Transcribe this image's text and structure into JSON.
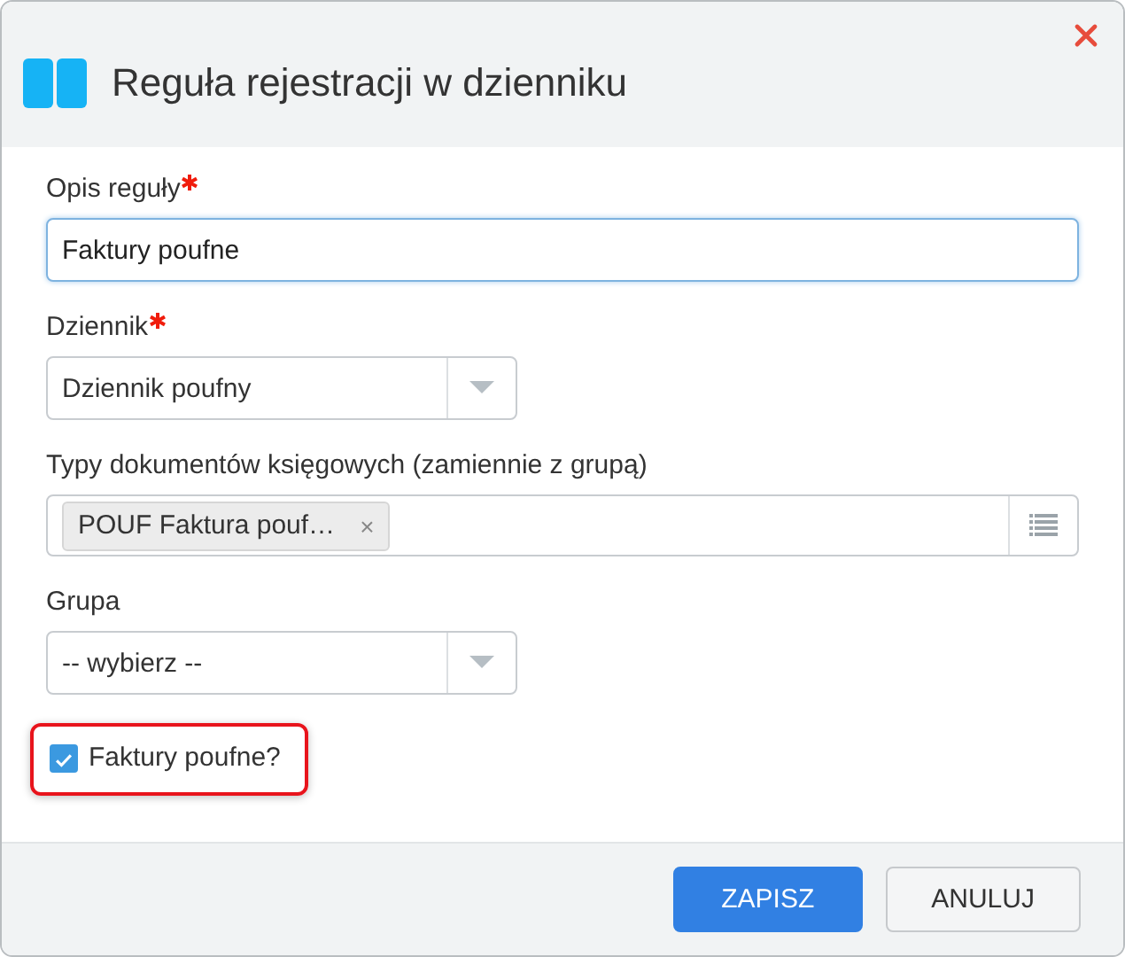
{
  "window": {
    "title": "Reguła rejestracji w dzienniku"
  },
  "fields": [
    {
      "kind": "text",
      "label": "Opis reguły",
      "required": true,
      "value": "Faktury poufne",
      "focused": true
    },
    {
      "kind": "select",
      "label": "Dziennik",
      "required": true,
      "value": "Dziennik poufny"
    },
    {
      "kind": "multiselect",
      "label": "Typy dokumentów księgowych (zamiennie z grupą)",
      "required": false,
      "tags": [
        {
          "label": "POUF Faktura pouf…",
          "remove": "×"
        }
      ]
    },
    {
      "kind": "select",
      "label": "Grupa",
      "required": false,
      "value": "-- wybierz --"
    }
  ],
  "checkbox": {
    "label": "Faktury poufne?",
    "checked": true,
    "highlighted": true
  },
  "buttons": [
    {
      "label": "ZAPISZ",
      "primary": true
    },
    {
      "label": "ANULUJ",
      "primary": false
    }
  ]
}
